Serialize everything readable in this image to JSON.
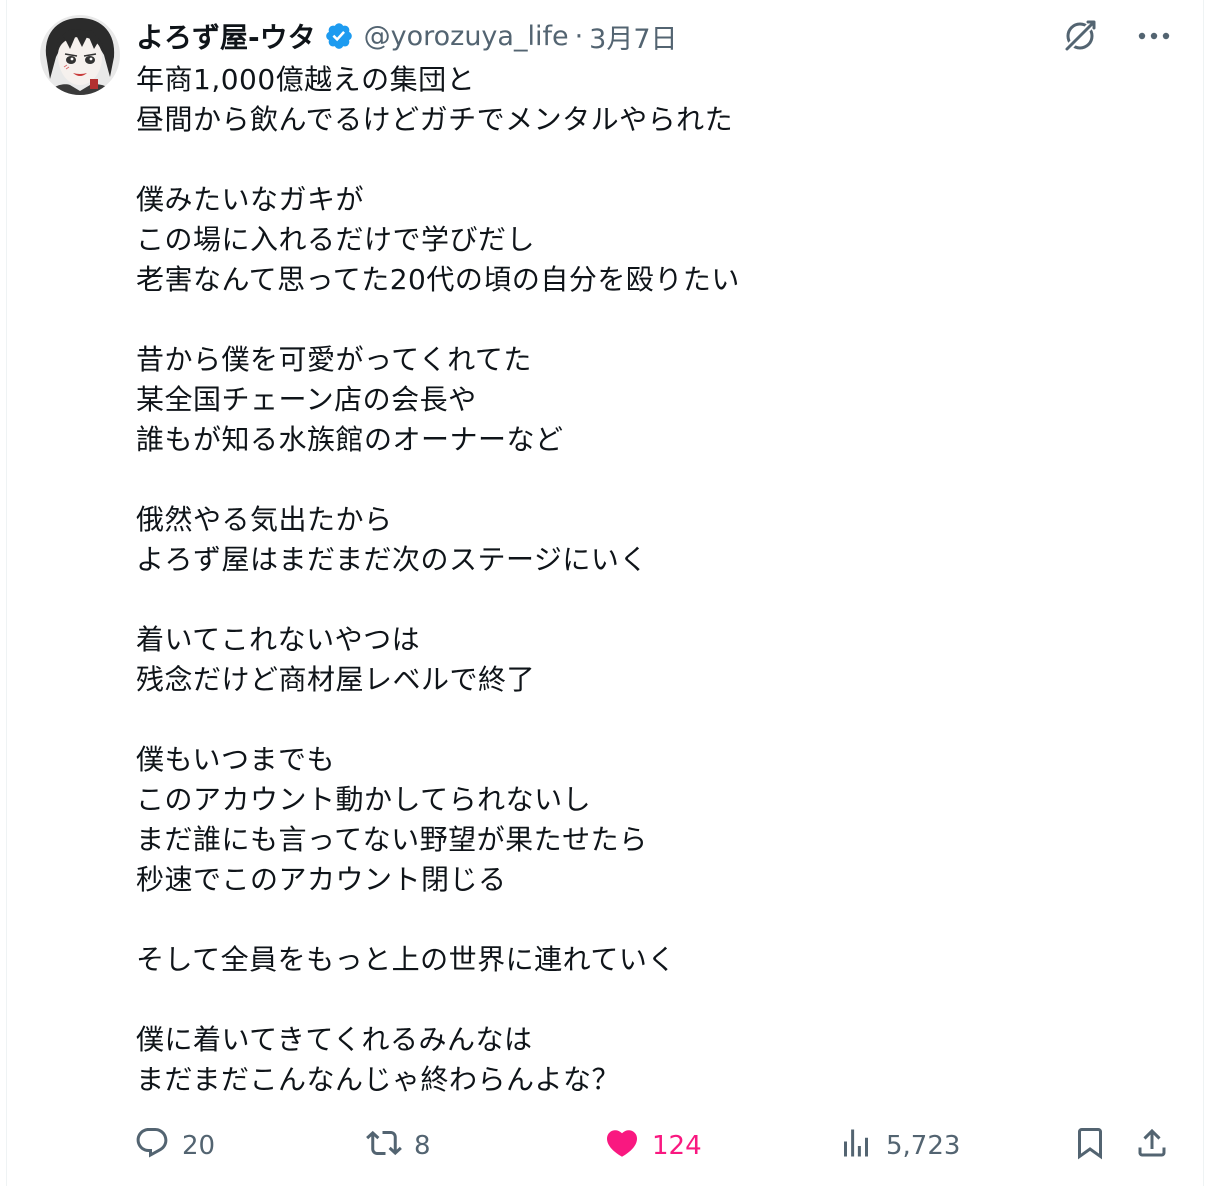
{
  "author": {
    "display_name": "よろず屋-ウタ",
    "handle": "@yorozuya_life",
    "separator": "·",
    "date": "3月7日"
  },
  "icons": {
    "avatar": "avatar-illustration",
    "verified": "verified-badge-icon",
    "grok": "grok-icon",
    "more": "more-options-icon",
    "reply": "reply-icon",
    "retweet": "retweet-icon",
    "like": "like-heart-icon",
    "views": "views-chart-icon",
    "bookmark": "bookmark-icon",
    "share": "share-icon"
  },
  "colors": {
    "text": "#0f1419",
    "secondary": "#536471",
    "verified_blue": "#1d9bf0",
    "like_pink": "#f91880"
  },
  "tweet": {
    "lines": [
      "年商1,000億越えの集団と",
      "昼間から飲んでるけどガチでメンタルやられた",
      "",
      "僕みたいなガキが",
      "この場に入れるだけで学びだし",
      "老害なんて思ってた20代の頃の自分を殴りたい",
      "",
      "昔から僕を可愛がってくれてた",
      "某全国チェーン店の会長や",
      "誰もが知る水族館のオーナーなど",
      "",
      "俄然やる気出たから",
      "よろず屋はまだまだ次のステージにいく",
      "",
      "着いてこれないやつは",
      "残念だけど商材屋レベルで終了",
      "",
      "僕もいつまでも",
      "このアカウント動かしてられないし",
      "まだ誰にも言ってない野望が果たせたら",
      "秒速でこのアカウント閉じる",
      "",
      "そして全員をもっと上の世界に連れていく",
      "",
      "僕に着いてきてくれるみんなは",
      "まだまだこんなんじゃ終わらんよな？"
    ]
  },
  "metrics": {
    "replies": "20",
    "retweets": "8",
    "likes": "124",
    "liked": true,
    "views": "5,723"
  }
}
